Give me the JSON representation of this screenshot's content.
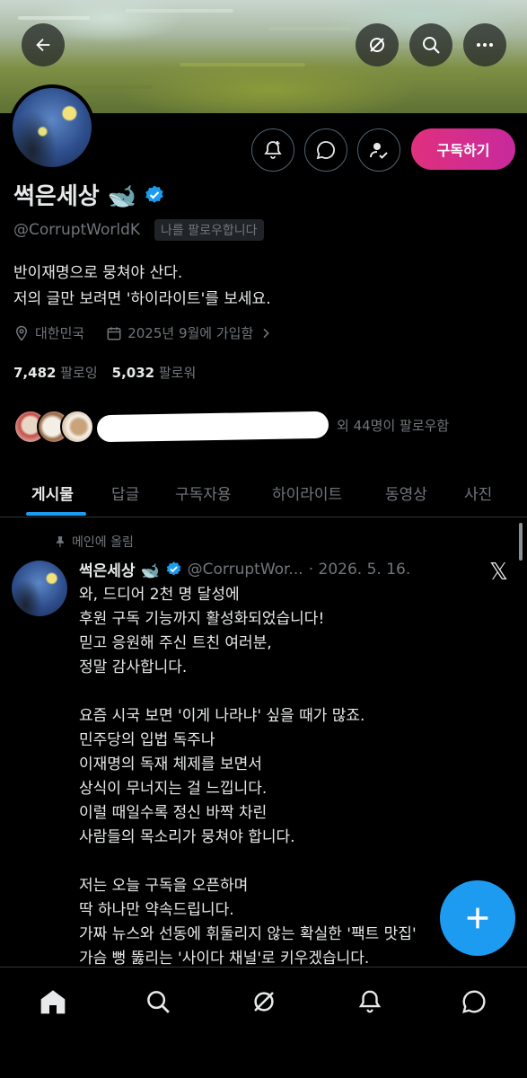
{
  "header": {
    "back_icon": "back-arrow-icon",
    "grok_icon": "grok-icon",
    "search_icon": "search-icon",
    "more_icon": "more-icon"
  },
  "profile": {
    "name": "썩은세상 🐋",
    "handle": "@CorruptWorldK",
    "follows_you": "나를 팔로우합니다",
    "bio_line1": "반이재명으로 뭉쳐야 산다.",
    "bio_line2": "저의 글만 보려면 '하이라이트'를 보세요.",
    "location": "대한민국",
    "joined": "2025년 9월에 가입함",
    "following_count": "7,482",
    "following_label": "팔로잉",
    "followers_count": "5,032",
    "followers_label": "팔로워",
    "mutuals_text": "외 44명이 팔로우함",
    "subscribe_label": "구독하기"
  },
  "tabs": [
    {
      "label": "게시물",
      "active": true
    },
    {
      "label": "답글",
      "active": false
    },
    {
      "label": "구독자용",
      "active": false
    },
    {
      "label": "하이라이트",
      "active": false
    },
    {
      "label": "동영상",
      "active": false
    },
    {
      "label": "사진",
      "active": false
    }
  ],
  "post": {
    "pinned_label": "메인에 올림",
    "name": "썩은세상 🐋",
    "handle": "@CorruptWor...",
    "date": "· 2026. 5. 16.",
    "body": "와, 드디어 2천 명 달성에\n후원 구독 기능까지 활성화되었습니다!\n믿고 응원해 주신 트친 여러분,\n정말 감사합니다.\n\n요즘 시국 보면 '이게 나라냐' 싶을 때가 많죠.\n민주당의 입법 독주나\n이재명의 독재 체제를 보면서\n상식이 무너지는 걸 느낍니다.\n이럴 때일수록 정신 바짝 차린\n사람들의 목소리가 뭉쳐야 합니다.\n\n저는 오늘 구독을 오픈하며\n딱 하나만 약속드립니다.\n가짜 뉴스와 선동에 휘둘리지 않는 확실한 '팩트 맛집'\n가슴 뻥 뚫리는 '사이다 채널'로 키우겠습니다.",
    "x_logo": "𝕏"
  },
  "colors": {
    "accent": "#1d9bf0",
    "subscribe_gradient_start": "#e0307e",
    "subscribe_gradient_end": "#c72a9c",
    "secondary_text": "#71767b"
  }
}
